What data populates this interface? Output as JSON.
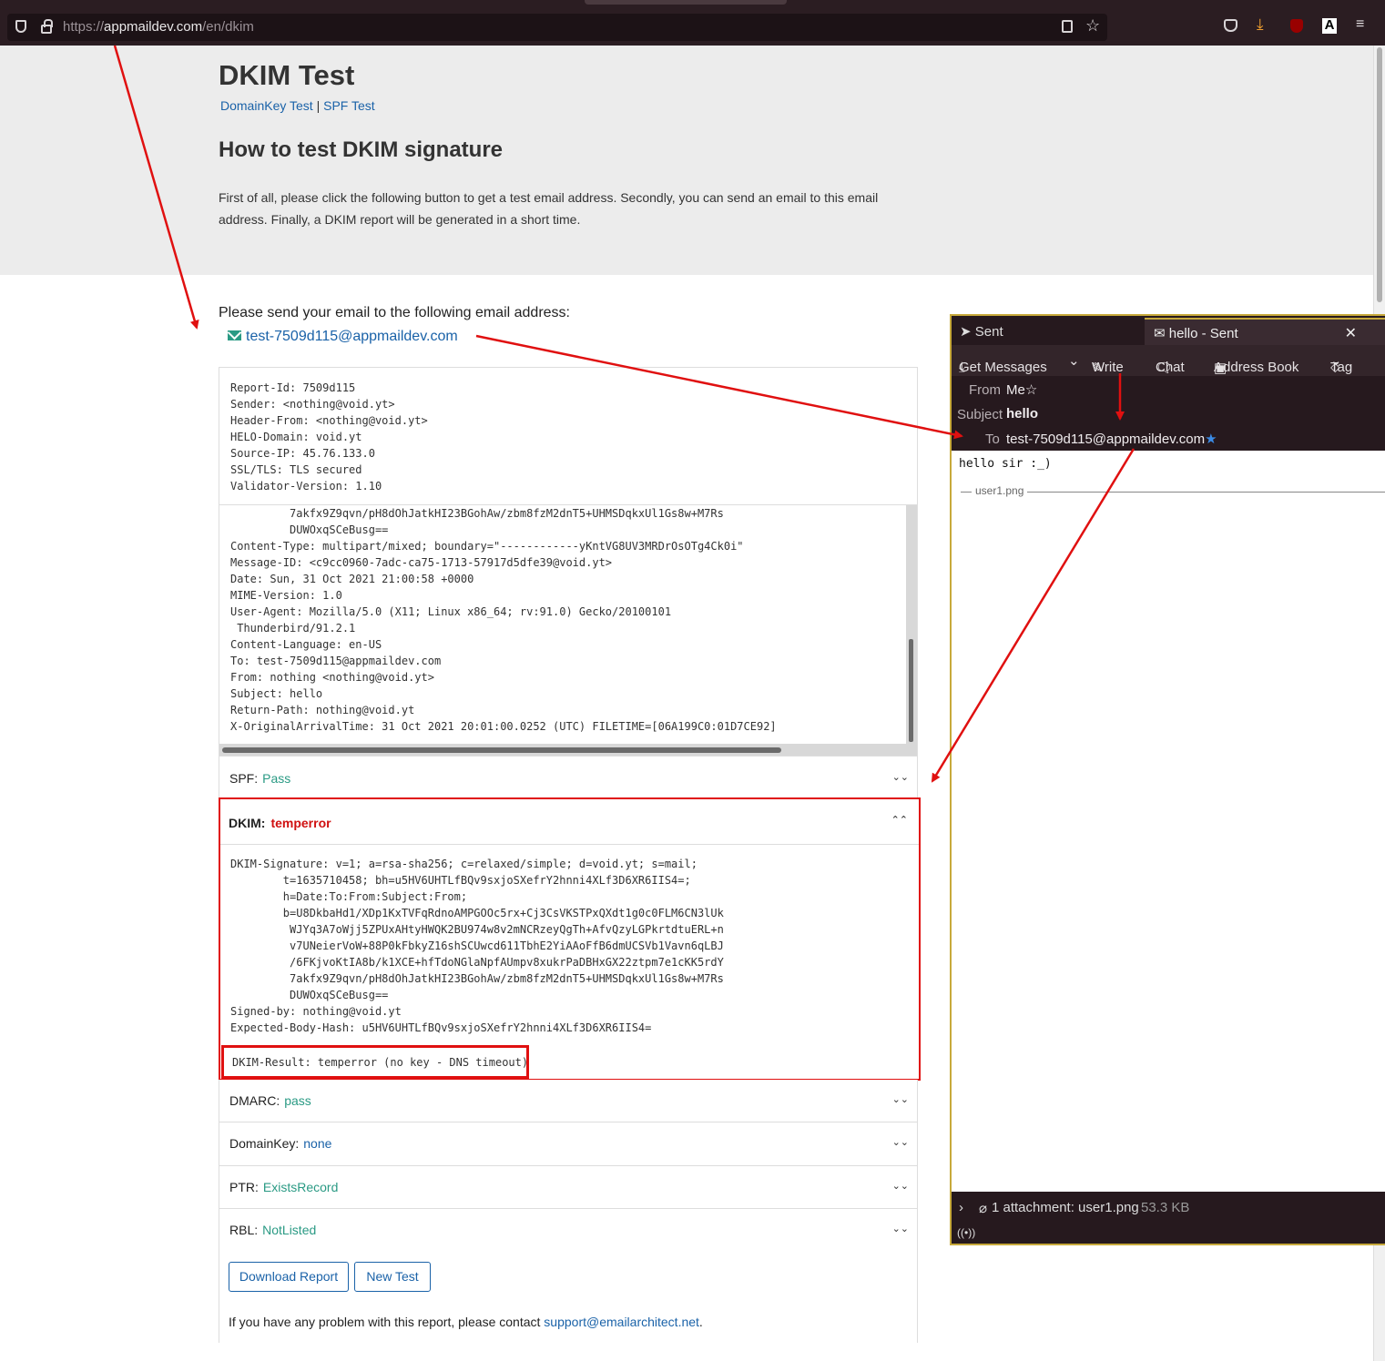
{
  "browser": {
    "url_prefix": "https://",
    "url_host": "appmaildev.com",
    "url_path": "/en/dkim",
    "toolbar_icons": [
      "reader-icon",
      "bookmark-star-icon",
      "pocket-icon",
      "download-icon",
      "ublock-icon",
      "font-icon",
      "menu-icon"
    ]
  },
  "page": {
    "title": "DKIM Test",
    "nav_links": [
      "DomainKey Test",
      "SPF Test"
    ],
    "nav_separator": "|",
    "subtitle": "How to test DKIM signature",
    "intro": "First of all, please click the following button to get a test email address. Secondly, you can send an email to this email address. Finally, a DKIM report will be generated in a short time.",
    "send_prompt": "Please send your email to the following email address:",
    "test_email": "test-7509d115@appmaildev.com"
  },
  "report": {
    "meta": "Report-Id: 7509d115\nSender: <nothing@void.yt>\nHeader-From: <nothing@void.yt>\nHELO-Domain: void.yt\nSource-IP: 45.76.133.0\nSSL/TLS: TLS secured\nValidator-Version: 1.10",
    "headers": "         7akfx9Z9qvn/pH8dOhJatkHI23BGohAw/zbm8fzM2dnT5+UHMSDqkxUl1Gs8w+M7Rs\n         DUWOxqSCeBusg==\nContent-Type: multipart/mixed; boundary=\"------------yKntVG8UV3MRDrOsOTg4Ck0i\"\nMessage-ID: <c9cc0960-7adc-ca75-1713-57917d5dfe39@void.yt>\nDate: Sun, 31 Oct 2021 21:00:58 +0000\nMIME-Version: 1.0\nUser-Agent: Mozilla/5.0 (X11; Linux x86_64; rv:91.0) Gecko/20100101\n Thunderbird/91.2.1\nContent-Language: en-US\nTo: test-7509d115@appmaildev.com\nFrom: nothing <nothing@void.yt>\nSubject: hello\nReturn-Path: nothing@void.yt\nX-OriginalArrivalTime: 31 Oct 2021 20:01:00.0252 (UTC) FILETIME=[06A199C0:01D7CE92]",
    "spf": {
      "label": "SPF:",
      "value": "Pass"
    },
    "dkim": {
      "label": "DKIM:",
      "value": "temperror",
      "details": "DKIM-Signature: v=1; a=rsa-sha256; c=relaxed/simple; d=void.yt; s=mail;\n        t=1635710458; bh=u5HV6UHTLfBQv9sxjoSXefrY2hnni4XLf3D6XR6IIS4=;\n        h=Date:To:From:Subject:From;\n        b=U8DkbaHd1/XDp1KxTVFqRdnoAMPGOOc5rx+Cj3CsVKSTPxQXdt1g0c0FLM6CN3lUk\n         WJYq3A7oWjj5ZPUxAHtyHWQK2BU974w8v2mNCRzeyQgTh+AfvQzyLGPkrtdtuERL+n\n         v7UNeierVoW+88P0kFbkyZ16shSCUwcd611TbhE2YiAAoFfB6dmUCSVb1Vavn6qLBJ\n         /6FKjvoKtIA8b/k1XCE+hfTdoNGlaNpfAUmpv8xukrPaDBHxGX22ztpm7e1cKK5rdY\n         7akfx9Z9qvn/pH8dOhJatkHI23BGohAw/zbm8fzM2dnT5+UHMSDqkxUl1Gs8w+M7Rs\n         DUWOxqSCeBusg==\nSigned-by: nothing@void.yt\nExpected-Body-Hash: u5HV6UHTLfBQv9sxjoSXefrY2hnni4XLf3D6XR6IIS4=",
      "result": "DKIM-Result: temperror (no key - DNS timeout)"
    },
    "dmarc": {
      "label": "DMARC:",
      "value": "pass"
    },
    "domainkey": {
      "label": "DomainKey:",
      "value": "none"
    },
    "ptr": {
      "label": "PTR:",
      "value": "ExistsRecord"
    },
    "rbl": {
      "label": "RBL:",
      "value": "NotListed"
    },
    "buttons": {
      "download": "Download Report",
      "new_test": "New Test"
    },
    "footer_text": "If you have any problem with this report, please contact ",
    "footer_email": "support@emailarchitect.net",
    "footer_end": "."
  },
  "thunderbird": {
    "tab_sent": "Sent",
    "tab_message": "hello - Sent",
    "toolbar": {
      "get_messages": "Get Messages",
      "write": "Write",
      "chat": "Chat",
      "address_book": "Address Book",
      "tag": "Tag"
    },
    "from_label": "From",
    "from_value": "Me",
    "subject_label": "Subject",
    "subject_value": "hello",
    "to_label": "To",
    "to_value": "test-7509d115@appmaildev.com",
    "body": "hello sir :_)",
    "attachment_name": "user1.png",
    "attachment_summary": "1 attachment: user1.png",
    "attachment_size": "53.3 KB"
  },
  "colors": {
    "annotation": "#e01010",
    "pass": "#2a9a84",
    "link": "#1a62a8",
    "error": "#d01010"
  }
}
